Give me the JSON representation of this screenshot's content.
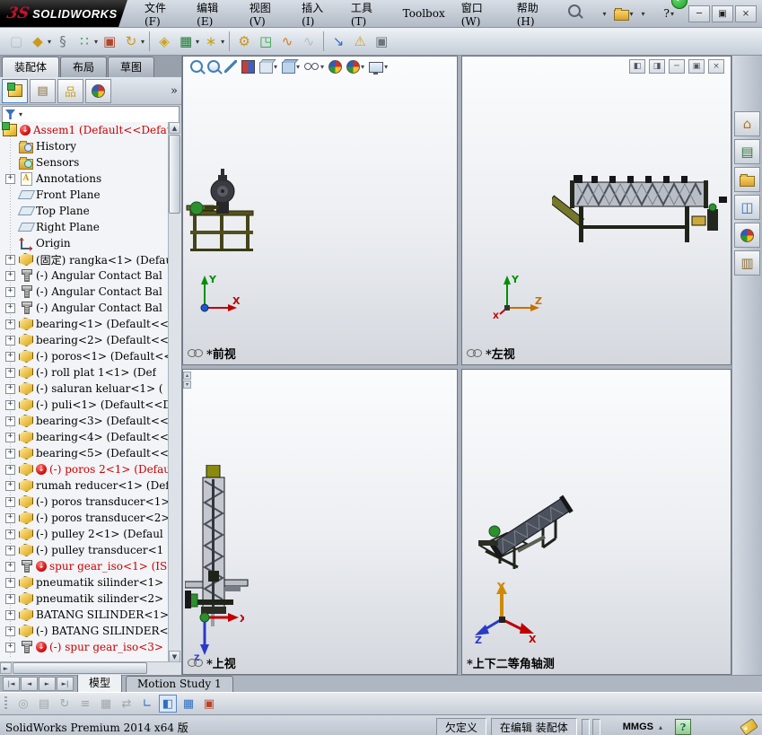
{
  "window": {
    "logo_mark": "3S",
    "logo_text": "SOLIDWORKS",
    "menus": [
      "文件(F)",
      "编辑(E)",
      "视图(V)",
      "插入(I)",
      "工具(T)",
      "Toolbox",
      "窗口(W)",
      "帮助(H)"
    ],
    "tray_check": "✓",
    "window_buttons": [
      {
        "name": "minimize-button",
        "glyph": "─"
      },
      {
        "name": "restore-button",
        "glyph": "▣"
      },
      {
        "name": "close-button",
        "glyph": "×"
      }
    ]
  },
  "quick_access": [
    {
      "name": "new-document-button",
      "type": "page",
      "dropdown": true
    },
    {
      "name": "open-document-button",
      "type": "folder",
      "dropdown": true
    },
    {
      "name": "save-button",
      "type": "floppy",
      "dropdown": true
    },
    {
      "name": "status-light-button",
      "type": "traffic"
    },
    {
      "name": "help-button",
      "type": "help",
      "glyph": "?",
      "dropdown": true
    }
  ],
  "toolbar": {
    "icons": [
      {
        "name": "insert-components",
        "glyph": "▢",
        "color": "#8f969e",
        "disabled": true
      },
      {
        "name": "open-part",
        "glyph": "◆",
        "color": "#c99a1e",
        "dropdown": true
      },
      {
        "name": "mate",
        "glyph": "§",
        "color": "#6d747c"
      },
      {
        "name": "component-pattern",
        "glyph": "∷",
        "color": "#2f9e44",
        "dropdown": true
      },
      {
        "name": "smart-fasteners",
        "glyph": "▣",
        "color": "#b5452a"
      },
      {
        "name": "rotate-component",
        "glyph": "↻",
        "color": "#c99a1e",
        "dropdown": true
      },
      {
        "sep": true
      },
      {
        "name": "move-component",
        "glyph": "◈",
        "color": "#c9a51e"
      },
      {
        "name": "show-hidden-components",
        "glyph": "▦",
        "color": "#1f7a33",
        "dropdown": true
      },
      {
        "name": "assembly-features",
        "glyph": "∗",
        "color": "#caa21c",
        "dropdown": true
      },
      {
        "sep": true
      },
      {
        "name": "gear-mates",
        "glyph": "⚙",
        "color": "#c9921e"
      },
      {
        "name": "exploded-view",
        "glyph": "◳",
        "color": "#2f9e44"
      },
      {
        "name": "explode-line-sketch",
        "glyph": "∿",
        "color": "#d07a1f"
      },
      {
        "name": "instant-3d",
        "glyph": "∿",
        "color": "#8f969e",
        "disabled": true
      },
      {
        "sep": true
      },
      {
        "name": "interference-detection",
        "glyph": "↘",
        "color": "#2f6fbf"
      },
      {
        "name": "assembly-xpert",
        "glyph": "⚠",
        "color": "#d0a51f"
      },
      {
        "name": "take-snapshot",
        "glyph": "▣",
        "color": "#6d747c"
      }
    ]
  },
  "left_panel": {
    "tabs": [
      {
        "label": "装配体",
        "active": true
      },
      {
        "label": "布局",
        "active": false
      },
      {
        "label": "草图",
        "active": false
      }
    ],
    "expand_chevrons": "»",
    "manager_tabs": [
      {
        "name": "feature-manager-tab",
        "type": "assembly",
        "active": true
      },
      {
        "name": "property-manager-tab",
        "type": "property",
        "glyph": "▤",
        "color": "#8a6d3b"
      },
      {
        "name": "configuration-manager-tab",
        "type": "configuration",
        "glyph": "品",
        "color": "#caa21c"
      },
      {
        "name": "display-manager-tab",
        "type": "ball"
      }
    ],
    "tree": {
      "items": [
        {
          "label": "Assem1  (Default<<Defaul",
          "icon": "assembly",
          "error": true,
          "red": true,
          "root": true
        },
        {
          "label": "History",
          "icon": "history"
        },
        {
          "label": "Sensors",
          "icon": "sensors"
        },
        {
          "label": "Annotations",
          "icon": "annotations",
          "expand": true
        },
        {
          "label": "Front Plane",
          "icon": "plane"
        },
        {
          "label": "Top Plane",
          "icon": "plane"
        },
        {
          "label": "Right Plane",
          "icon": "plane"
        },
        {
          "label": "Origin",
          "icon": "origin"
        },
        {
          "label": "(固定) rangka<1> (Defaul",
          "icon": "part",
          "expand": true
        },
        {
          "label": "(-) Angular Contact Bal",
          "icon": "bolt",
          "expand": true
        },
        {
          "label": "(-) Angular Contact Bal",
          "icon": "bolt",
          "expand": true
        },
        {
          "label": "(-) Angular Contact Bal",
          "icon": "bolt",
          "expand": true
        },
        {
          "label": "bearing<1> (Default<<De",
          "icon": "part",
          "expand": true
        },
        {
          "label": "bearing<2> (Default<<De",
          "icon": "part",
          "expand": true
        },
        {
          "label": "(-) poros<1> (Default<<",
          "icon": "part",
          "expand": true
        },
        {
          "label": "(-) roll plat 1<1> (Def",
          "icon": "part",
          "expand": true
        },
        {
          "label": "(-) saluran keluar<1> (",
          "icon": "part",
          "expand": true
        },
        {
          "label": "(-) puli<1> (Default<<D",
          "icon": "part",
          "expand": true
        },
        {
          "label": "bearing<3> (Default<<De",
          "icon": "part",
          "expand": true
        },
        {
          "label": "bearing<4> (Default<<De",
          "icon": "part",
          "expand": true
        },
        {
          "label": "bearing<5> (Default<<De",
          "icon": "part",
          "expand": true
        },
        {
          "label": "(-) poros 2<1> (Defau",
          "icon": "part",
          "expand": true,
          "error": true,
          "red": true
        },
        {
          "label": "rumah reducer<1> (Defaul",
          "icon": "part",
          "expand": true
        },
        {
          "label": "(-) poros transducer<1>",
          "icon": "part",
          "expand": true
        },
        {
          "label": "(-) poros transducer<2>",
          "icon": "part",
          "expand": true
        },
        {
          "label": "(-) pulley 2<1> (Defaul",
          "icon": "part",
          "expand": true
        },
        {
          "label": "(-) pulley transducer<1",
          "icon": "part",
          "expand": true
        },
        {
          "label": "spur gear_iso<1> (ISO",
          "icon": "bolt",
          "expand": true,
          "error": true,
          "red": true
        },
        {
          "label": "pneumatik silinder<1> (",
          "icon": "part",
          "expand": true
        },
        {
          "label": "pneumatik silinder<2> (",
          "icon": "part",
          "expand": true
        },
        {
          "label": "BATANG SILINDER<1> (Def",
          "icon": "part",
          "expand": true
        },
        {
          "label": "(-) BATANG SILINDER<2>",
          "icon": "part",
          "expand": true
        },
        {
          "label": "(-) spur gear_iso<3>",
          "icon": "bolt",
          "expand": true,
          "error": true,
          "red": true
        }
      ]
    }
  },
  "viewport": {
    "hud": [
      {
        "name": "zoom-to-fit",
        "type": "mag"
      },
      {
        "name": "zoom-to-area",
        "type": "magplus"
      },
      {
        "name": "previous-view",
        "type": "wand"
      },
      {
        "name": "section-view",
        "type": "section"
      },
      {
        "name": "view-orientation",
        "type": "cube",
        "dropdown": true
      },
      {
        "name": "display-style",
        "type": "cube2",
        "dropdown": true
      },
      {
        "name": "hide-show-items",
        "type": "glasses",
        "dropdown": true
      },
      {
        "name": "edit-appearance",
        "type": "ball"
      },
      {
        "name": "apply-scene",
        "type": "ball2",
        "dropdown": true
      },
      {
        "name": "view-settings",
        "type": "monitor",
        "dropdown": true
      }
    ],
    "doc_controls": [
      {
        "name": "pane-split-left",
        "glyph": "◧"
      },
      {
        "name": "pane-split-right",
        "glyph": "◨"
      },
      {
        "name": "minimize-doc",
        "glyph": "─"
      },
      {
        "name": "restore-doc",
        "glyph": "▣"
      },
      {
        "name": "close-doc",
        "glyph": "×"
      }
    ],
    "panes": [
      {
        "label": "*前视",
        "chain": true
      },
      {
        "label": "*左视",
        "chain": true
      },
      {
        "label": "*上视",
        "chain": true
      },
      {
        "label": "*上下二等角轴测",
        "chain": false
      }
    ]
  },
  "task_pane": [
    {
      "name": "home-tab",
      "glyph": "⌂",
      "color": "#b8741a"
    },
    {
      "name": "design-library-tab",
      "glyph": "▤",
      "color": "#2f7a3a"
    },
    {
      "name": "file-explorer-tab",
      "type": "folder"
    },
    {
      "name": "view-palette-tab",
      "glyph": "◫",
      "color": "#2f6fbf"
    },
    {
      "name": "appearances-tab",
      "type": "ball"
    },
    {
      "name": "custom-properties-tab",
      "glyph": "▥",
      "color": "#8a6d3b"
    }
  ],
  "doc_tabs": {
    "nav": [
      {
        "name": "first-tab-button",
        "glyph": "|◄"
      },
      {
        "name": "prev-tab-button",
        "glyph": "◄"
      },
      {
        "name": "next-tab-button",
        "glyph": "►"
      },
      {
        "name": "last-tab-button",
        "glyph": "►|"
      }
    ],
    "tabs": [
      {
        "label": "模型",
        "active": true
      },
      {
        "label": "Motion Study 1",
        "active": false
      }
    ]
  },
  "bottom_toolbar": {
    "icons": [
      {
        "name": "filter-filmstrip",
        "glyph": "◎",
        "color": "#556",
        "disabled": true
      },
      {
        "name": "key-properties",
        "glyph": "▤",
        "color": "#556",
        "disabled": true
      },
      {
        "name": "animation-wizard",
        "glyph": "↻",
        "color": "#556",
        "disabled": true
      },
      {
        "name": "timeline-lines",
        "glyph": "≡",
        "color": "#556",
        "disabled": true
      },
      {
        "name": "grid-snap",
        "glyph": "▦",
        "color": "#556",
        "disabled": true
      },
      {
        "name": "expand-collapse",
        "glyph": "⇄",
        "color": "#556",
        "disabled": true
      },
      {
        "name": "coordinate-system",
        "glyph": "∟",
        "color": "#2f6fbf"
      },
      {
        "name": "shaded-cube-view",
        "glyph": "◧",
        "color": "#2f6fbf",
        "active": true
      },
      {
        "name": "table-view",
        "glyph": "▦",
        "color": "#2f6fbf"
      },
      {
        "name": "save-table",
        "glyph": "▣",
        "color": "#b5452a"
      }
    ]
  },
  "status_bar": {
    "product": "SolidWorks Premium 2014 x64 版",
    "constraint_state": "欠定义",
    "editing_state": "在编辑 装配体",
    "units": "MMGS",
    "help_glyph": "?"
  }
}
